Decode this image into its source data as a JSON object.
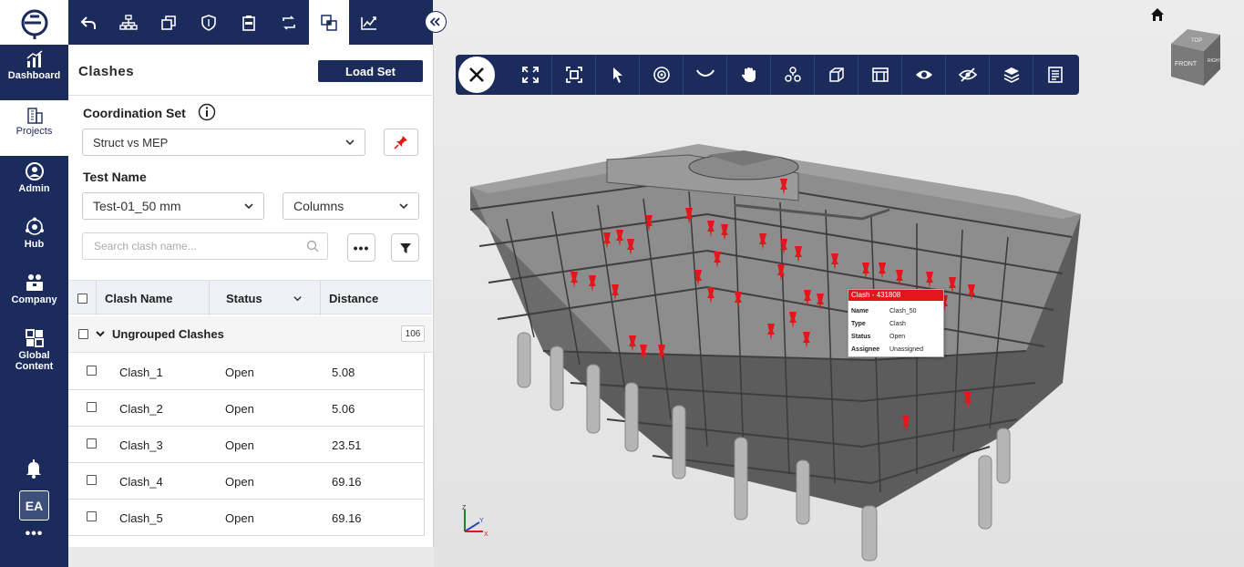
{
  "nav": {
    "items": [
      {
        "label": "Dashboard"
      },
      {
        "label": "Projects"
      },
      {
        "label": "Admin"
      },
      {
        "label": "Hub"
      },
      {
        "label": "Company"
      },
      {
        "label": "Global Content"
      }
    ],
    "avatar": "EA",
    "more": "•••"
  },
  "panel": {
    "title": "Clashes",
    "load_set": "Load Set",
    "coordination_label": "Coordination Set",
    "coordination_value": "Struct vs MEP",
    "test_label": "Test Name",
    "test_value": "Test-01_50 mm",
    "element_value": "Columns",
    "search_placeholder": "Search clash name...",
    "more": "•••",
    "columns": {
      "name": "Clash Name",
      "status": "Status",
      "distance": "Distance"
    },
    "group": {
      "label": "Ungrouped Clashes",
      "count": "106"
    },
    "rows": [
      {
        "name": "Clash_1",
        "status": "Open",
        "distance": "5.08"
      },
      {
        "name": "Clash_2",
        "status": "Open",
        "distance": "5.06"
      },
      {
        "name": "Clash_3",
        "status": "Open",
        "distance": "23.51"
      },
      {
        "name": "Clash_4",
        "status": "Open",
        "distance": "69.16"
      },
      {
        "name": "Clash_5",
        "status": "Open",
        "distance": "69.16"
      }
    ]
  },
  "viewer": {
    "tooltip": {
      "title": "Clash - 431808",
      "fields": [
        {
          "k": "Name",
          "v": "Clash_50"
        },
        {
          "k": "Type",
          "v": "Clash"
        },
        {
          "k": "Status",
          "v": "Open"
        },
        {
          "k": "Assignee",
          "v": "Unassigned"
        }
      ]
    },
    "viewcube": {
      "top": "TOP",
      "front": "FRONT",
      "right": "RIGHT"
    },
    "axes": {
      "z": "Z",
      "y": "Y",
      "x": "X"
    }
  },
  "colors": {
    "brand": "#1a2b5c",
    "clash": "#e5161b"
  }
}
